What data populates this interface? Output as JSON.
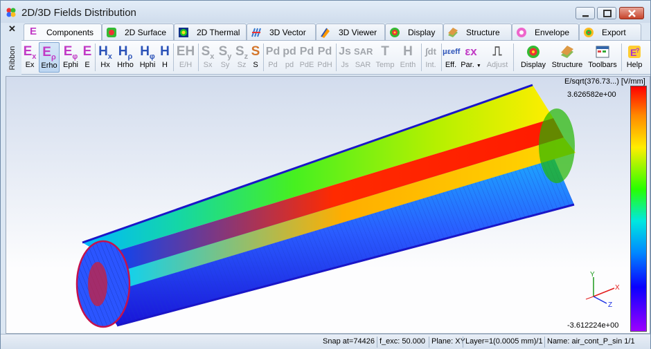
{
  "window": {
    "title": "2D/3D Fields Distribution"
  },
  "ribbon": {
    "close_label": "✕",
    "side_label": "Ribbon"
  },
  "tabs": [
    {
      "label": "Components",
      "icon": "e-field-icon"
    },
    {
      "label": "2D Surface",
      "icon": "surface-icon"
    },
    {
      "label": "2D Thermal",
      "icon": "thermal-icon"
    },
    {
      "label": "3D Vector",
      "icon": "vector-icon"
    },
    {
      "label": "3D Viewer",
      "icon": "viewer-icon"
    },
    {
      "label": "Display",
      "icon": "display-icon"
    },
    {
      "label": "Structure",
      "icon": "structure-icon"
    },
    {
      "label": "Envelope",
      "icon": "envelope-icon"
    },
    {
      "label": "Export",
      "icon": "export-icon"
    }
  ],
  "toolbar": {
    "ex": {
      "glyph": "E",
      "sub": "x",
      "label": "Ex"
    },
    "erho": {
      "glyph": "E",
      "sub": "ρ",
      "label": "Erho"
    },
    "ephi": {
      "glyph": "E",
      "sub": "φ",
      "label": "Ephi"
    },
    "e": {
      "glyph": "E",
      "label": "E"
    },
    "hx": {
      "glyph": "H",
      "sub": "x",
      "label": "Hx"
    },
    "hrho": {
      "glyph": "H",
      "sub": "ρ",
      "label": "Hrho"
    },
    "hphi": {
      "glyph": "H",
      "sub": "φ",
      "label": "Hphi"
    },
    "h": {
      "glyph": "H",
      "label": "H"
    },
    "eh": {
      "glyph": "EH",
      "label": "E/H"
    },
    "sx": {
      "glyph": "S",
      "sub": "x",
      "label": "Sx"
    },
    "sy": {
      "glyph": "S",
      "sub": "y",
      "label": "Sy"
    },
    "sz": {
      "glyph": "S",
      "sub": "z",
      "label": "Sz"
    },
    "s": {
      "glyph": "S",
      "label": "S"
    },
    "pd": {
      "glyph": "Pd",
      "label": "Pd"
    },
    "pd2": {
      "glyph": "pd",
      "label": "pd"
    },
    "pde": {
      "glyph": "Pd",
      "label": "PdE"
    },
    "pdh": {
      "glyph": "Pd",
      "label": "PdH"
    },
    "js": {
      "glyph": "Js",
      "label": "Js"
    },
    "sar": {
      "glyph": "SAR",
      "label": "SAR"
    },
    "temp": {
      "glyph": "T",
      "label": "Temp"
    },
    "enth": {
      "glyph": "H",
      "label": "Enth"
    },
    "int": {
      "glyph": "∫dt",
      "label": "Int."
    },
    "eff": {
      "glyph": "μεeff",
      "label": "Eff."
    },
    "par": {
      "glyph": "εx",
      "label": "Par."
    },
    "adjust": {
      "glyph": "⎍",
      "label": "Adjust"
    },
    "display": {
      "label": "Display"
    },
    "structure": {
      "label": "Structure"
    },
    "toolbars": {
      "label": "Toolbars"
    },
    "help": {
      "label": "Help"
    }
  },
  "legend": {
    "title": "E/sqrt(376.73...) [V/mm]",
    "max": "3.626582e+00",
    "min": "-3.612224e+00"
  },
  "axes": {
    "x": "X",
    "y": "Y",
    "z": "Z"
  },
  "status": {
    "snap": "Snap at=74426",
    "fexc": "f_exc: 50.000",
    "plane": "Plane: XY",
    "layer": "Layer=1(0.0005 mm)/1",
    "name": "Name: air_cont_P_sin 1/1"
  },
  "colors": {
    "accent": "#c13ac5",
    "h_blue": "#2c53b8",
    "selected": "#bcd6f1"
  }
}
